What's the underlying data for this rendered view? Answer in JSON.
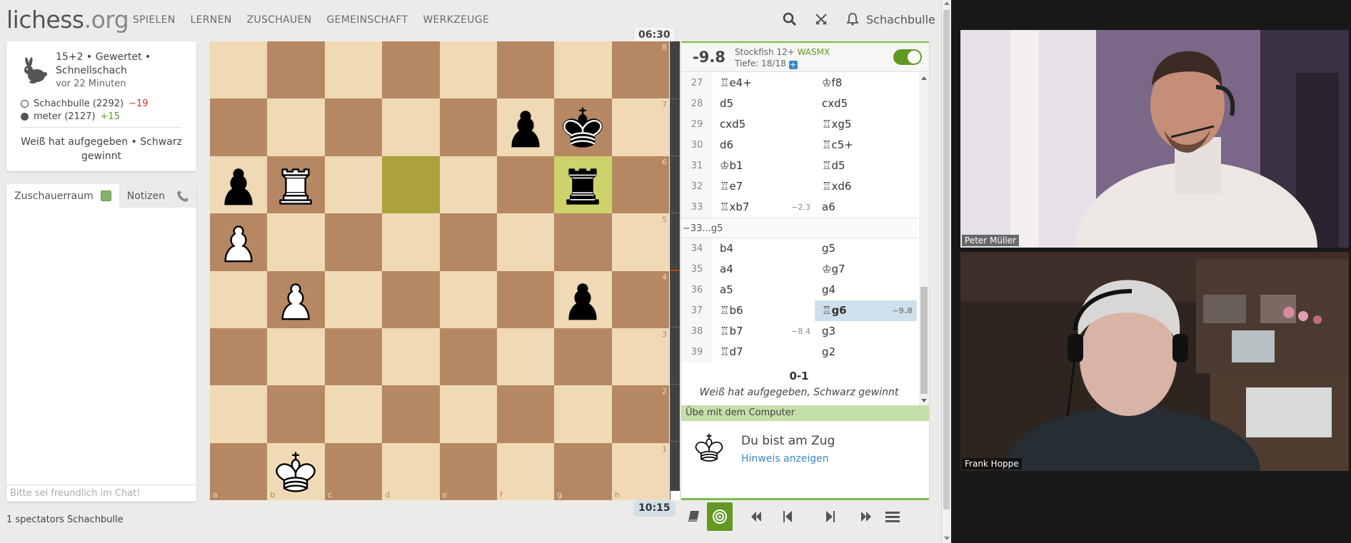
{
  "header": {
    "logo_main": "lichess",
    "logo_tld": ".org",
    "nav": [
      "SPIELEN",
      "LERNEN",
      "ZUSCHAUEN",
      "GEMEINSCHAFT",
      "WERKZEUGE"
    ],
    "username": "Schachbulle"
  },
  "game_info": {
    "line1": "15+2 • Gewertet • Schnellschach",
    "ago": "vor 22 Minuten",
    "white_player": "Schachbulle (2292)",
    "white_diff": "−19",
    "black_player": "meter (2127)",
    "black_diff": "+15",
    "result": "Weiß hat aufgegeben • Schwarz gewinnt"
  },
  "chat": {
    "tab_room": "Zuschauerraum",
    "tab_notes": "Notizen",
    "placeholder": "Bitte sei freundlich im Chat!"
  },
  "spectators": "1 spectators Schachbulle",
  "clocks": {
    "top": "06:30",
    "bottom": "10:15"
  },
  "board": {
    "ranks": [
      "8",
      "7",
      "6",
      "5",
      "4",
      "3",
      "2",
      "1"
    ],
    "files": [
      "a",
      "b",
      "c",
      "d",
      "e",
      "f",
      "g",
      "h"
    ],
    "position": [
      [
        "",
        "",
        "",
        "",
        "",
        "",
        "",
        ""
      ],
      [
        "",
        "",
        "",
        "",
        "",
        "p",
        "k",
        ""
      ],
      [
        "p",
        "R",
        "",
        "",
        "",
        "",
        "r",
        ""
      ],
      [
        "P",
        "",
        "",
        "",
        "",
        "",
        "",
        ""
      ],
      [
        "",
        "P",
        "",
        "",
        "",
        "",
        "p",
        ""
      ],
      [
        "",
        "",
        "",
        "",
        "",
        "",
        "",
        ""
      ],
      [
        "",
        "",
        "",
        "",
        "",
        "",
        "",
        ""
      ],
      [
        "",
        "K",
        "",
        "",
        "",
        "",
        "",
        ""
      ]
    ],
    "last_move": [
      "d6",
      "g6"
    ],
    "colors": {
      "light": "#f0d9b5",
      "dark": "#b58863"
    }
  },
  "eval_gauge": {
    "white_fraction": 0.02
  },
  "ceval": {
    "score": "-9.8",
    "engine": "Stockfish 12+",
    "engine_badge": "WASMX",
    "depth": "Tiefe: 18/18",
    "plus": "+"
  },
  "moves": {
    "rows1": [
      {
        "n": "27",
        "w": "♖e4+",
        "we": "",
        "b": "♔f8",
        "be": ""
      },
      {
        "n": "28",
        "w": "d5",
        "we": "",
        "b": "cxd5",
        "be": ""
      },
      {
        "n": "29",
        "w": "cxd5",
        "we": "",
        "b": "♖xg5",
        "be": ""
      },
      {
        "n": "30",
        "w": "d6",
        "we": "",
        "b": "♖c5+",
        "be": ""
      },
      {
        "n": "31",
        "w": "♔b1",
        "we": "",
        "b": "♖d5",
        "be": ""
      },
      {
        "n": "32",
        "w": "♖e7",
        "we": "",
        "b": "♖xd6",
        "be": ""
      },
      {
        "n": "33",
        "w": "♖xb7",
        "we": "−2.3",
        "b": "a6",
        "be": ""
      }
    ],
    "variation": "−33...g5",
    "rows2": [
      {
        "n": "34",
        "w": "b4",
        "we": "",
        "b": "g5",
        "be": ""
      },
      {
        "n": "35",
        "w": "a4",
        "we": "",
        "b": "♔g7",
        "be": ""
      },
      {
        "n": "36",
        "w": "a5",
        "we": "",
        "b": "g4",
        "be": ""
      },
      {
        "n": "37",
        "w": "♖b6",
        "we": "",
        "b": "♖g6",
        "be": "−9.8"
      },
      {
        "n": "38",
        "w": "♖b7",
        "we": "−8.4",
        "b": "g3",
        "be": ""
      },
      {
        "n": "39",
        "w": "♖d7",
        "we": "",
        "b": "g2",
        "be": ""
      }
    ],
    "active": "37b"
  },
  "result": {
    "score": "0-1",
    "text": "Weiß hat aufgegeben, Schwarz gewinnt"
  },
  "practice": {
    "title": "Übe mit dem Computer",
    "turn": "Du bist am Zug",
    "hint": "Hinweis anzeigen"
  },
  "video": {
    "person1": "Peter Müller",
    "person2": "Frank Hoppe"
  },
  "icons": {
    "search": "search-icon",
    "swords": "swords-icon",
    "bell": "bell-icon",
    "rabbit": "rabbit-icon",
    "phone": "phone-icon",
    "book": "book-icon",
    "target": "target-icon",
    "first": "first-move-icon",
    "prev": "prev-move-icon",
    "next": "next-move-icon",
    "last": "last-move-icon",
    "menu": "menu-icon"
  }
}
